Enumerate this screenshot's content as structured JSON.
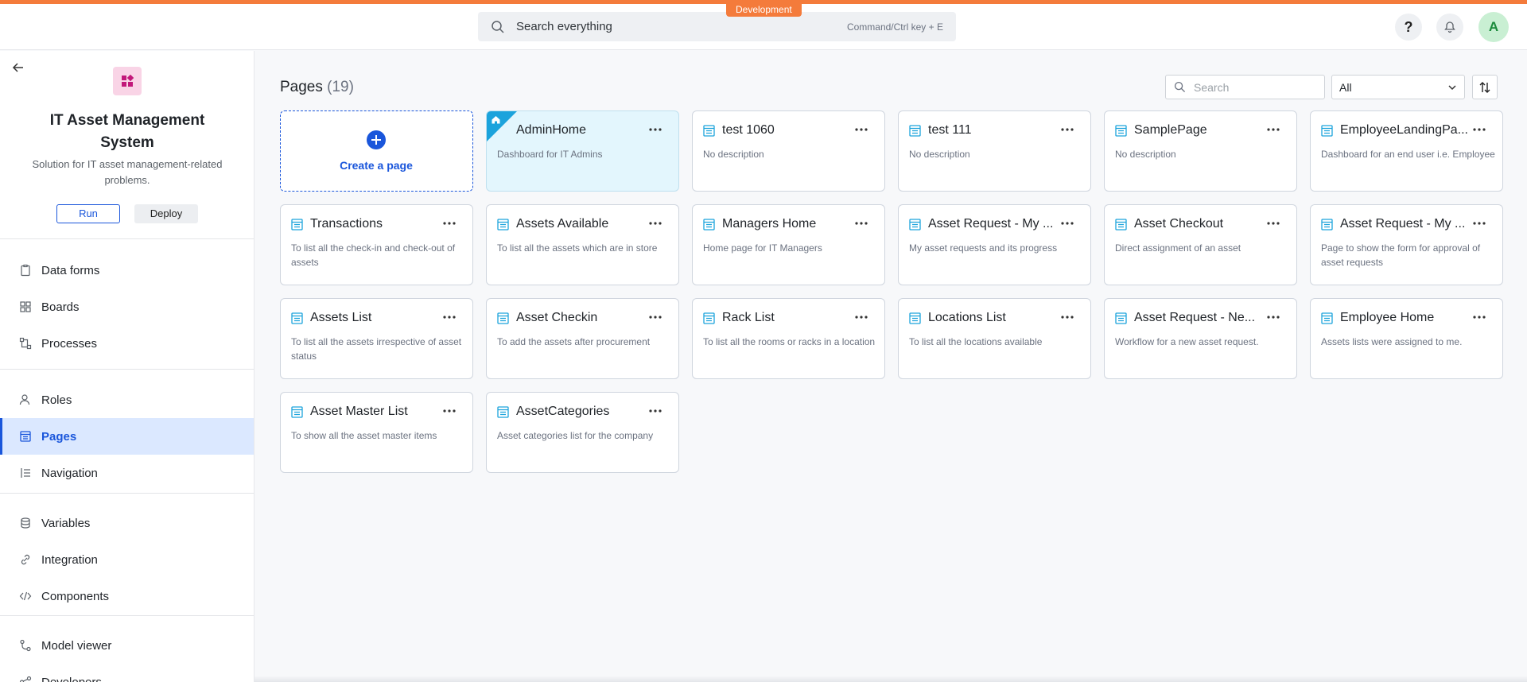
{
  "env": {
    "badge": "Development",
    "strip_color": "#f47b3b"
  },
  "topbar": {
    "search_placeholder": "Search everything",
    "search_hint": "Command/Ctrl key + E",
    "help_label": "?",
    "avatar_initial": "A"
  },
  "sidebar": {
    "app_title": "IT Asset Management System",
    "app_desc": "Solution for IT asset management-related problems.",
    "run_label": "Run",
    "deploy_label": "Deploy",
    "items": [
      {
        "label": "Data forms",
        "icon": "clipboard-icon"
      },
      {
        "label": "Boards",
        "icon": "grid-icon"
      },
      {
        "label": "Processes",
        "icon": "process-icon"
      },
      {
        "label": "Roles",
        "icon": "users-icon"
      },
      {
        "label": "Pages",
        "icon": "page-icon",
        "active": true
      },
      {
        "label": "Navigation",
        "icon": "navigation-icon"
      },
      {
        "label": "Variables",
        "icon": "database-icon"
      },
      {
        "label": "Integration",
        "icon": "link-icon"
      },
      {
        "label": "Components",
        "icon": "code-icon"
      },
      {
        "label": "Model viewer",
        "icon": "model-icon"
      },
      {
        "label": "Developers",
        "icon": "share-icon"
      }
    ]
  },
  "main": {
    "title": "Pages",
    "count": "(19)",
    "filter_search_placeholder": "Search",
    "filter_select_value": "All",
    "create_label": "Create a page",
    "accent": "#1a56db",
    "pages": [
      {
        "title": "AdminHome",
        "desc": "Dashboard for IT Admins",
        "home": true
      },
      {
        "title": "test 1060",
        "desc": "No description"
      },
      {
        "title": "test 111",
        "desc": "No description"
      },
      {
        "title": "SamplePage",
        "desc": "No description"
      },
      {
        "title": "EmployeeLandingPa...",
        "desc": "Dashboard for an end user i.e. Employee"
      },
      {
        "title": "Transactions",
        "desc": "To list all the check-in and check-out of assets"
      },
      {
        "title": "Assets Available",
        "desc": "To list all the assets which are in store"
      },
      {
        "title": "Managers Home",
        "desc": "Home page for IT Managers"
      },
      {
        "title": "Asset Request - My ...",
        "desc": "My asset requests and its progress"
      },
      {
        "title": "Asset Checkout",
        "desc": "Direct assignment of an asset"
      },
      {
        "title": "Asset Request - My ...",
        "desc": "Page to show the form for approval of asset requests"
      },
      {
        "title": "Assets List",
        "desc": "To list all the assets irrespective of asset status"
      },
      {
        "title": "Asset Checkin",
        "desc": "To add the assets after procurement"
      },
      {
        "title": "Rack List",
        "desc": "To list all the rooms or racks in a location"
      },
      {
        "title": "Locations List",
        "desc": "To list all the locations available"
      },
      {
        "title": "Asset Request - Ne...",
        "desc": "Workflow for a new asset request."
      },
      {
        "title": "Employee Home",
        "desc": "Assets lists were assigned to me."
      },
      {
        "title": "Asset Master List",
        "desc": "To show all the asset master items"
      },
      {
        "title": "AssetCategories",
        "desc": "Asset categories list for the company"
      }
    ]
  }
}
